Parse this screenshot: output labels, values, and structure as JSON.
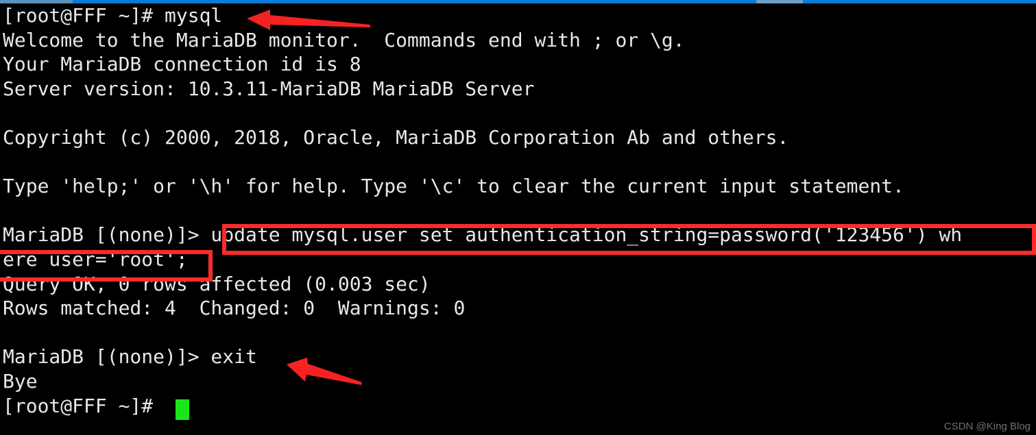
{
  "window": {
    "chrome_accent_color": "#0b7ad6",
    "terminal_background": "#000000",
    "terminal_foreground": "#e8e8e8"
  },
  "terminal": {
    "prompt_shell": "[root@FFF ~]#",
    "prompt_mysql": "MariaDB [(none)]>",
    "cursor": {
      "color": "#19e619",
      "shape": "block"
    },
    "lines": [
      {
        "id": "l01",
        "text": "[root@FFF ~]# mysql"
      },
      {
        "id": "l02",
        "text": "Welcome to the MariaDB monitor.  Commands end with ; or \\g."
      },
      {
        "id": "l03",
        "text": "Your MariaDB connection id is 8"
      },
      {
        "id": "l04",
        "text": "Server version: 10.3.11-MariaDB MariaDB Server"
      },
      {
        "id": "l05",
        "text": ""
      },
      {
        "id": "l06",
        "text": "Copyright (c) 2000, 2018, Oracle, MariaDB Corporation Ab and others."
      },
      {
        "id": "l07",
        "text": ""
      },
      {
        "id": "l08",
        "text": "Type 'help;' or '\\h' for help. Type '\\c' to clear the current input statement."
      },
      {
        "id": "l09",
        "text": ""
      },
      {
        "id": "l10",
        "text": "MariaDB [(none)]> update mysql.user set authentication_string=password('123456') wh"
      },
      {
        "id": "l11",
        "text": "ere user='root';"
      },
      {
        "id": "l12",
        "text": "Query OK, 0 rows affected (0.003 sec)"
      },
      {
        "id": "l13",
        "text": "Rows matched: 4  Changed: 0  Warnings: 0"
      },
      {
        "id": "l14",
        "text": ""
      },
      {
        "id": "l15",
        "text": "MariaDB [(none)]> exit"
      },
      {
        "id": "l16",
        "text": "Bye"
      },
      {
        "id": "l17",
        "text": "[root@FFF ~]# "
      }
    ],
    "commands": {
      "launch": "mysql",
      "sql_update": "update mysql.user set authentication_string=password('123456') where user='root';",
      "exit": "exit"
    },
    "results": {
      "query_status": "Query OK, 0 rows affected (0.003 sec)",
      "rows_matched": "Rows matched: 4  Changed: 0  Warnings: 0",
      "goodbye": "Bye"
    },
    "server": {
      "connection_id": "8",
      "version": "10.3.11-MariaDB MariaDB Server",
      "copyright": "Copyright (c) 2000, 2018, Oracle, MariaDB Corporation Ab and others."
    }
  },
  "annotations": {
    "highlight_color": "#fc2b2b",
    "boxes": [
      {
        "id": "box-sql-line1",
        "label": "sql-command-line-1"
      },
      {
        "id": "box-sql-line2",
        "label": "sql-command-line-2"
      }
    ],
    "arrows": [
      {
        "id": "arrow-mysql",
        "label": "points-to-mysql-command"
      },
      {
        "id": "arrow-exit",
        "label": "points-to-exit-command"
      }
    ]
  },
  "watermark": {
    "text": "CSDN @King Blog"
  }
}
